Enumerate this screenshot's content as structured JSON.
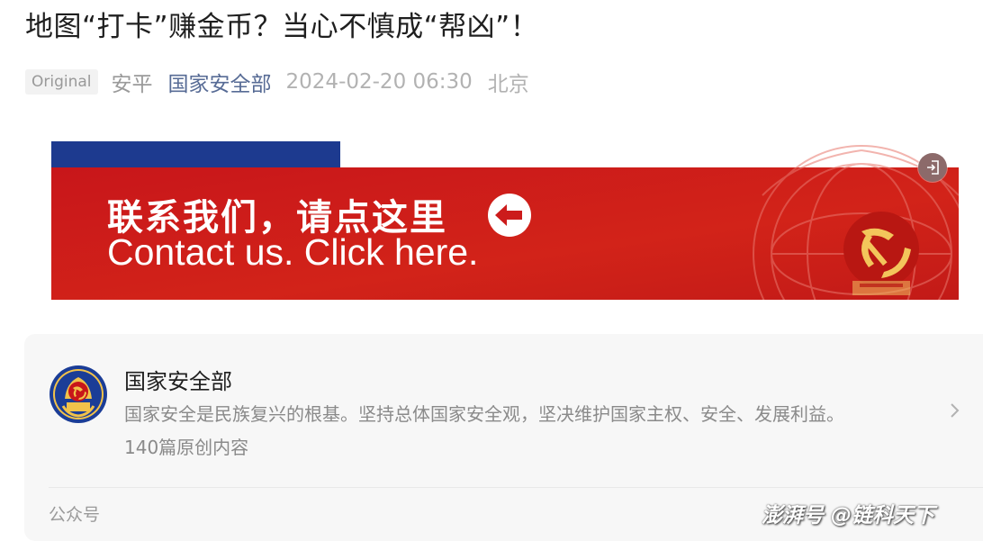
{
  "article": {
    "title": "地图“打卡”赚金币？当心不慎成“帮凶”！",
    "badge": "Original",
    "author": "安平",
    "account": "国家安全部",
    "datetime": "2024-02-20 06:30",
    "location": "北京"
  },
  "banner": {
    "title_cn": "联系我们，请点这里",
    "title_en": "Contact us. Click here.",
    "arrow_icon": "left-arrow-circle-icon",
    "emblem_icon": "hammer-sickle-emblem-icon",
    "colors": {
      "red": "#cc1b1b",
      "blue": "#1d3a8f"
    }
  },
  "float_button": {
    "icon": "exit-icon"
  },
  "account_card": {
    "name": "国家安全部",
    "description": "国家安全是民族复兴的根基。坚持总体国家安全观，坚决维护国家主权、安全、发展利益。",
    "count": "140篇原创内容",
    "footer_label": "公众号",
    "avatar_icon": "ministry-emblem-icon",
    "chevron_icon": "chevron-right-icon"
  },
  "watermark": {
    "text": "澎湃号 @链科天下"
  }
}
